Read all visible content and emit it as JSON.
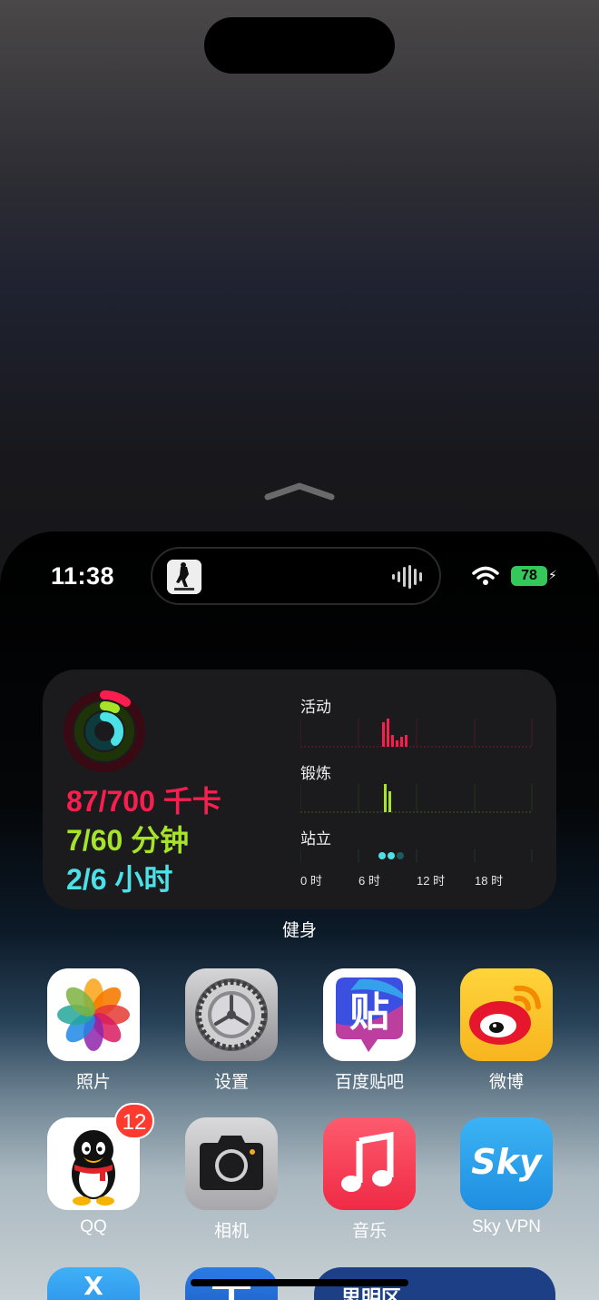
{
  "status": {
    "time": "11:38",
    "battery": "78"
  },
  "fitness": {
    "move": "87/700 千卡",
    "exercise": "7/60 分钟",
    "stand": "2/6 小时",
    "chart_titles": [
      "活动",
      "锻炼",
      "站立"
    ],
    "axis": [
      "0 时",
      "6 时",
      "12 时",
      "18 时"
    ],
    "colors": {
      "move": "#fa1e4f",
      "exercise": "#a6e42a",
      "stand": "#4ce1e7"
    },
    "widget_name": "健身"
  },
  "apps": [
    {
      "label": "照片",
      "icon": "photos-icon"
    },
    {
      "label": "设置",
      "icon": "settings-icon"
    },
    {
      "label": "百度贴吧",
      "icon": "tieba-icon",
      "glyph": "贴"
    },
    {
      "label": "微博",
      "icon": "weibo-icon"
    },
    {
      "label": "QQ",
      "icon": "qq-icon",
      "badge": "12"
    },
    {
      "label": "相机",
      "icon": "camera-icon"
    },
    {
      "label": "音乐",
      "icon": "music-icon"
    },
    {
      "label": "Sky VPN",
      "icon": "sky-vpn-icon",
      "glyph": "Sky"
    }
  ],
  "partial": {
    "text": "思明区"
  }
}
